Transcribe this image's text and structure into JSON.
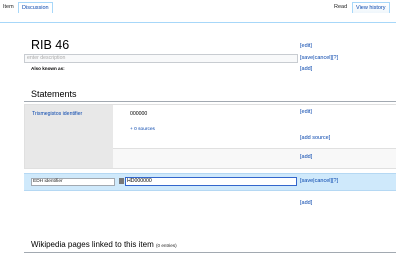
{
  "tabs": {
    "item": "Item",
    "discussion": "Discussion",
    "read": "Read",
    "view_history": "View history"
  },
  "entity": {
    "title": "RIB 46",
    "description_placeholder": "enter description",
    "also_known_as_label": "Also known as:"
  },
  "links": {
    "edit": "[edit]",
    "save_cancel_help": "[save|cancel][?]",
    "add": "[add]",
    "add_source": "[add source]"
  },
  "statements": {
    "heading": "Statements",
    "property": "Trismegistos identifier",
    "value": "000000",
    "sources": "+ 0 sources"
  },
  "editor": {
    "property_value": "EDH identifier",
    "value": "HD000000"
  },
  "wikipedia": {
    "heading": "Wikipedia pages linked to this item",
    "count": "(0 entries)"
  }
}
